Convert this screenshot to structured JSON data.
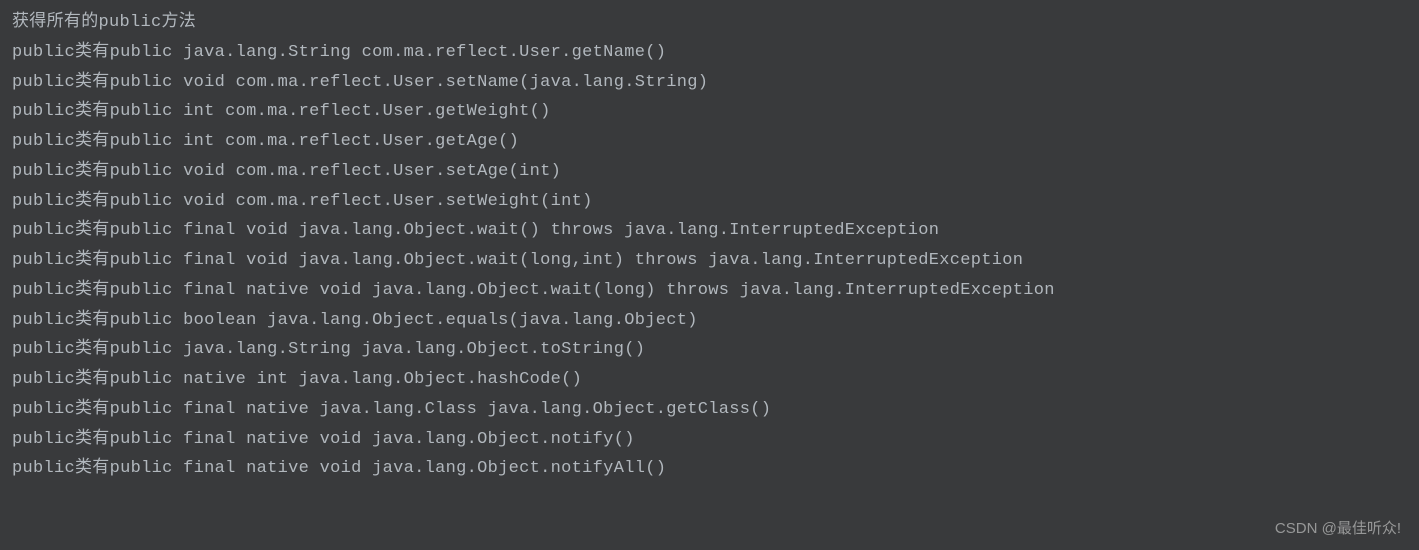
{
  "console": {
    "header": "获得所有的public方法",
    "lines": [
      "public类有public java.lang.String com.ma.reflect.User.getName()",
      "public类有public void com.ma.reflect.User.setName(java.lang.String)",
      "public类有public int com.ma.reflect.User.getWeight()",
      "public类有public int com.ma.reflect.User.getAge()",
      "public类有public void com.ma.reflect.User.setAge(int)",
      "public类有public void com.ma.reflect.User.setWeight(int)",
      "public类有public final void java.lang.Object.wait() throws java.lang.InterruptedException",
      "public类有public final void java.lang.Object.wait(long,int) throws java.lang.InterruptedException",
      "public类有public final native void java.lang.Object.wait(long) throws java.lang.InterruptedException",
      "public类有public boolean java.lang.Object.equals(java.lang.Object)",
      "public类有public java.lang.String java.lang.Object.toString()",
      "public类有public native int java.lang.Object.hashCode()",
      "public类有public final native java.lang.Class java.lang.Object.getClass()",
      "public类有public final native void java.lang.Object.notify()",
      "public类有public final native void java.lang.Object.notifyAll()"
    ]
  },
  "watermark": "CSDN @最佳听众!"
}
